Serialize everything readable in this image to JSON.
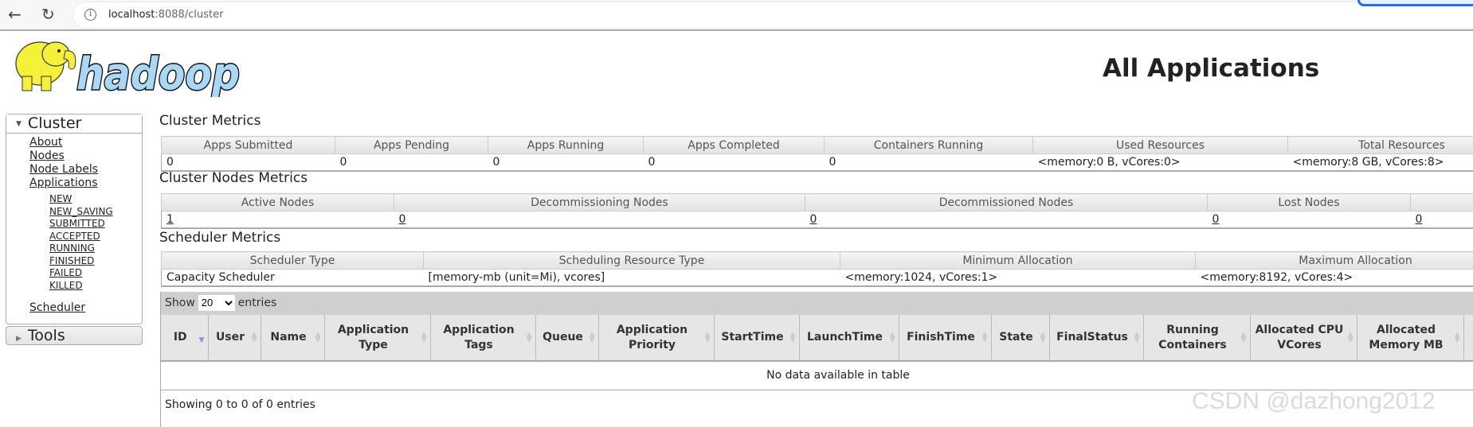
{
  "browser": {
    "url_host": "localhost",
    "url_rest": ":8088/cluster"
  },
  "logo": {
    "text": "hadoop"
  },
  "page_title": "All Applications",
  "sidebar": {
    "cluster_label": "Cluster",
    "items": [
      "About",
      "Nodes",
      "Node Labels",
      "Applications"
    ],
    "app_states": [
      "NEW",
      "NEW_SAVING",
      "SUBMITTED",
      "ACCEPTED",
      "RUNNING",
      "FINISHED",
      "FAILED",
      "KILLED"
    ],
    "scheduler": "Scheduler",
    "tools_label": "Tools"
  },
  "cluster_metrics": {
    "title": "Cluster Metrics",
    "headers": [
      "Apps Submitted",
      "Apps Pending",
      "Apps Running",
      "Apps Completed",
      "Containers Running",
      "Used Resources",
      "Total Resources"
    ],
    "values": [
      "0",
      "0",
      "0",
      "0",
      "0",
      "<memory:0 B, vCores:0>",
      "<memory:8 GB, vCores:8>"
    ]
  },
  "nodes_metrics": {
    "title": "Cluster Nodes Metrics",
    "headers": [
      "Active Nodes",
      "Decommissioning Nodes",
      "Decommissioned Nodes",
      "Lost Nodes",
      ""
    ],
    "values": [
      "1",
      "0",
      "0",
      "0",
      "0"
    ]
  },
  "scheduler_metrics": {
    "title": "Scheduler Metrics",
    "headers": [
      "Scheduler Type",
      "Scheduling Resource Type",
      "Minimum Allocation",
      "Maximum Allocation"
    ],
    "values": [
      "Capacity Scheduler",
      "[memory-mb (unit=Mi), vcores]",
      "<memory:1024, vCores:1>",
      "<memory:8192, vCores:4>"
    ]
  },
  "apps_table": {
    "show_label": "Show",
    "entries_label": "entries",
    "page_size": "20",
    "columns": [
      "ID",
      "User",
      "Name",
      "Application Type",
      "Application Tags",
      "Queue",
      "Application Priority",
      "StartTime",
      "LaunchTime",
      "FinishTime",
      "State",
      "FinalStatus",
      "Running Containers",
      "Allocated CPU VCores",
      "Allocated Memory MB",
      ""
    ],
    "empty_text": "No data available in table",
    "footer": "Showing 0 to 0 of 0 entries"
  },
  "watermark": "CSDN @dazhong2012"
}
